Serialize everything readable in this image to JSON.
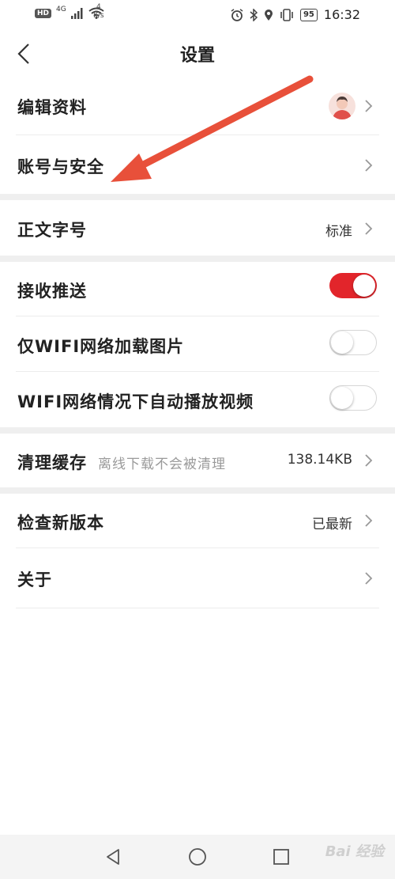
{
  "statusbar": {
    "hd": "HD",
    "network": "4G",
    "speed_value": "4",
    "speed_unit": "K/s",
    "battery": "95",
    "time": "16:32"
  },
  "header": {
    "title": "设置"
  },
  "settings": {
    "edit_profile": {
      "label": "编辑资料"
    },
    "account_security": {
      "label": "账号与安全"
    },
    "font_size": {
      "label": "正文字号",
      "value": "标准"
    },
    "push": {
      "label": "接收推送",
      "enabled": true
    },
    "wifi_images": {
      "label": "仅WIFI网络加载图片",
      "enabled": false
    },
    "wifi_autoplay": {
      "label": "WIFI网络情况下自动播放视频",
      "enabled": false
    },
    "clear_cache": {
      "label": "清理缓存",
      "hint": "离线下载不会被清理",
      "value": "138.14KB"
    },
    "check_update": {
      "label": "检查新版本",
      "value": "已最新"
    },
    "about": {
      "label": "关于"
    }
  },
  "watermark": "Bai 经验",
  "colors": {
    "accent": "#e2252b",
    "annotation_arrow": "#e8503a",
    "section_gap": "#efefef"
  }
}
